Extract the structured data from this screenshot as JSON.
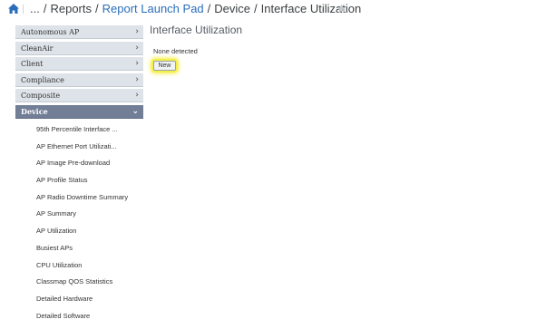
{
  "breadcrumb": {
    "ellipsis": "...",
    "items": [
      "Reports",
      "Report Launch Pad",
      "Device",
      "Interface Utilization"
    ],
    "separator": "/"
  },
  "colors": {
    "link": "#2a6ebb",
    "active_category": "#717e96",
    "category_bg": "#dde3e8",
    "highlight": "#f3f04a"
  },
  "sidebar": {
    "categories": [
      {
        "label": "Autonomous AP",
        "icon": "chevron-right-icon"
      },
      {
        "label": "CleanAir",
        "icon": "chevron-right-icon"
      },
      {
        "label": "Client",
        "icon": "chevron-right-icon"
      },
      {
        "label": "Compliance",
        "icon": "chevron-right-icon"
      },
      {
        "label": "Composite",
        "icon": "chevron-right-icon"
      },
      {
        "label": "Device",
        "icon": "chevron-down-icon",
        "active": true
      }
    ],
    "device_reports": [
      "95th Percentile Interface ...",
      "AP Ethernet Port Utilizati...",
      "AP Image Pre-download",
      "AP Profile Status",
      "AP Radio Downtime Summary",
      "AP Summary",
      "AP Utilization",
      "Busiest APs",
      "CPU Utilization",
      "Classmap QOS Statistics",
      "Detailed Hardware",
      "Detailed Software"
    ]
  },
  "main": {
    "title": "Interface Utilization",
    "status": "None detected",
    "new_button": "New"
  }
}
